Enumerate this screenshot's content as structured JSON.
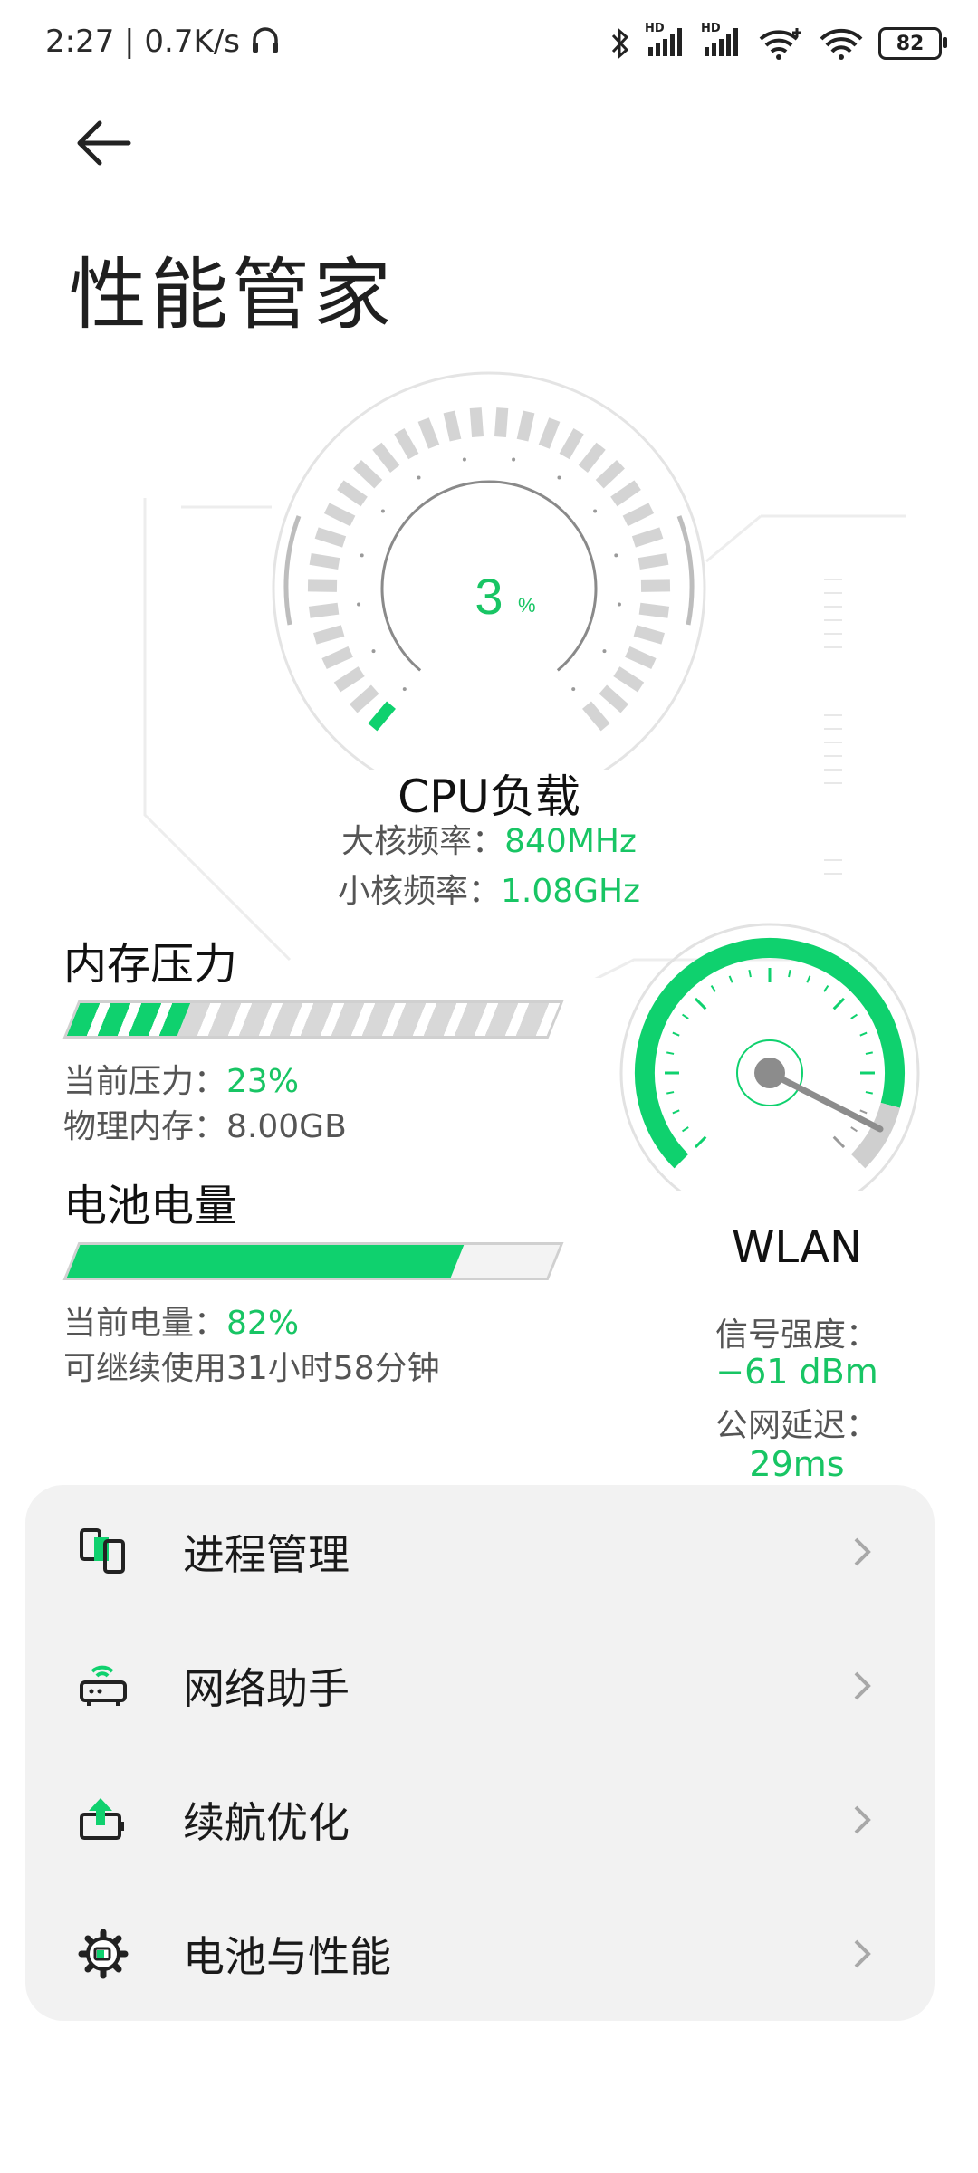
{
  "status_bar": {
    "time_speed": "2:27 | 0.7K/s",
    "hd1": "HD",
    "hd2": "HD",
    "battery": "82",
    "icons": [
      "headphones-icon",
      "bluetooth-icon",
      "signal-icon",
      "signal-icon",
      "wifi-plus-icon",
      "wifi-icon",
      "battery-icon"
    ]
  },
  "header": {
    "back_icon": "back-arrow-icon",
    "title": "性能管家"
  },
  "cpu": {
    "value": "3",
    "unit": "%",
    "load_percent": 3,
    "title": "CPU负载",
    "big_core_label": "大核频率：",
    "big_core_value": "840MHz",
    "small_core_label": "小核频率：",
    "small_core_value": "1.08GHz"
  },
  "memory": {
    "title": "内存压力",
    "pressure_label": "当前压力：",
    "pressure_value": "23%",
    "pressure_fraction": 0.23,
    "physical_label": "物理内存：",
    "physical_value": "8.00GB"
  },
  "battery": {
    "title": "电池电量",
    "level_label": "当前电量：",
    "level_value": "82%",
    "level_fraction": 0.82,
    "remaining": "可继续使用31小时58分钟"
  },
  "wlan": {
    "title": "WLAN",
    "signal_label": "信号强度：",
    "signal_value": "−61 dBm",
    "latency_label": "公网延迟：",
    "latency_value": "29ms"
  },
  "menu": [
    {
      "label": "进程管理",
      "icon": "process-manage-icon"
    },
    {
      "label": "网络助手",
      "icon": "network-router-icon"
    },
    {
      "label": "续航优化",
      "icon": "battery-boost-icon"
    },
    {
      "label": "电池与性能",
      "icon": "gear-battery-icon"
    }
  ],
  "colors": {
    "accent": "#0fd16e",
    "text_value": "#18c564",
    "card_bg": "#f2f2f2"
  }
}
